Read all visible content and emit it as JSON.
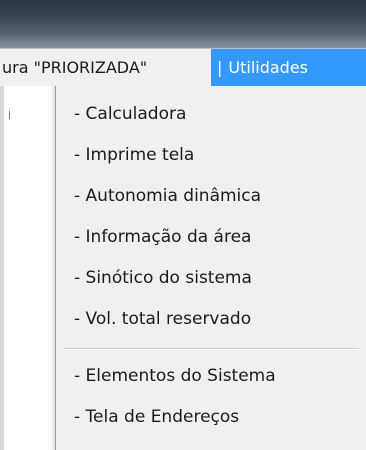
{
  "menubar": {
    "items": [
      {
        "label": "ura \"PRIORIZADA\""
      },
      {
        "label": "Utilidades",
        "separator": "|"
      }
    ]
  },
  "dropdown": {
    "group1": [
      {
        "label": "- Calculadora"
      },
      {
        "label": "- Imprime tela"
      },
      {
        "label": "- Autonomia dinâmica"
      },
      {
        "label": "- Informação da área"
      },
      {
        "label": "- Sinótico do sistema"
      },
      {
        "label": "- Vol. total reservado"
      }
    ],
    "group2": [
      {
        "label": "- Elementos do Sistema"
      },
      {
        "label": "- Tela de Endereços"
      }
    ]
  },
  "colors": {
    "highlight": "#3399ff",
    "menu_background": "#f0f0f0",
    "titlebar": "#3a4352"
  }
}
